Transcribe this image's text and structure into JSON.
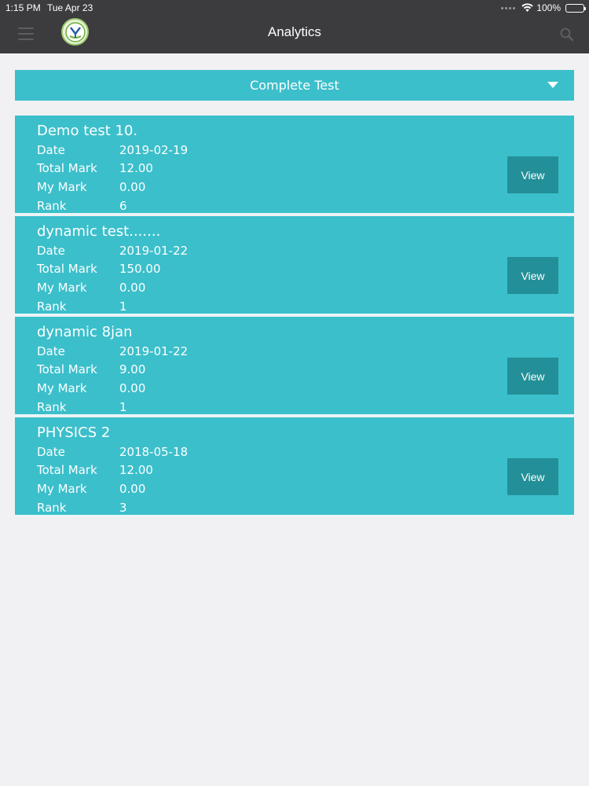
{
  "status_bar": {
    "time": "1:15 PM",
    "date": "Tue Apr 23",
    "battery": "100%",
    "icons": [
      "cellular-dots-icon",
      "wifi-icon",
      "battery-icon"
    ]
  },
  "header": {
    "title": "Analytics",
    "menu_icon": "hamburger-menu-icon",
    "logo_icon": "app-logo-icon",
    "search_icon": "search-icon"
  },
  "filter": {
    "selected": "Complete Test",
    "icon": "caret-down-icon"
  },
  "labels": {
    "date": "Date",
    "total_mark": "Total Mark",
    "my_mark": "My Mark",
    "rank": "Rank",
    "view": "View"
  },
  "tests": [
    {
      "title": "Demo test 10.",
      "date": "2019-02-19",
      "total_mark": "12.00",
      "my_mark": "0.00",
      "rank": "6"
    },
    {
      "title": "dynamic test.......",
      "date": "2019-01-22",
      "total_mark": "150.00",
      "my_mark": "0.00",
      "rank": "1"
    },
    {
      "title": "dynamic 8jan",
      "date": "2019-01-22",
      "total_mark": "9.00",
      "my_mark": "0.00",
      "rank": "1"
    },
    {
      "title": "PHYSICS 2",
      "date": "2018-05-18",
      "total_mark": "12.00",
      "my_mark": "0.00",
      "rank": "3"
    }
  ],
  "colors": {
    "header_bg": "#3c3c3e",
    "accent": "#3bbfcb",
    "button": "#238f98",
    "page_bg": "#f1f1f3"
  }
}
